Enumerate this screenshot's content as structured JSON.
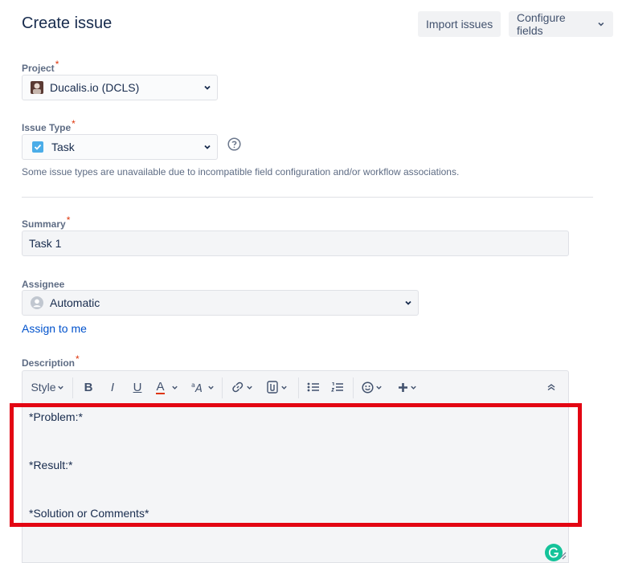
{
  "page": {
    "title": "Create issue"
  },
  "header": {
    "import_label": "Import issues",
    "configure_label": "Configure fields"
  },
  "project": {
    "label": "Project",
    "required_mark": "*",
    "value": "Ducalis.io (DCLS)"
  },
  "issue_type": {
    "label": "Issue Type",
    "required_mark": "*",
    "value": "Task",
    "hint": "Some issue types are unavailable due to incompatible field configuration and/or workflow associations."
  },
  "summary": {
    "label": "Summary",
    "required_mark": "*",
    "value": "Task 1"
  },
  "assignee": {
    "label": "Assignee",
    "value": "Automatic",
    "assign_link": "Assign to me"
  },
  "description": {
    "label": "Description",
    "required_mark": "*",
    "toolbar": {
      "style": "Style",
      "bold": "B",
      "italic": "I",
      "underline": "U",
      "text_color": "A"
    },
    "lines": [
      "*Problem:*",
      "*Result:*",
      "*Solution or Comments*"
    ]
  },
  "colors": {
    "accent": "#0052cc",
    "highlight": "#e30613",
    "required": "#de350b"
  }
}
